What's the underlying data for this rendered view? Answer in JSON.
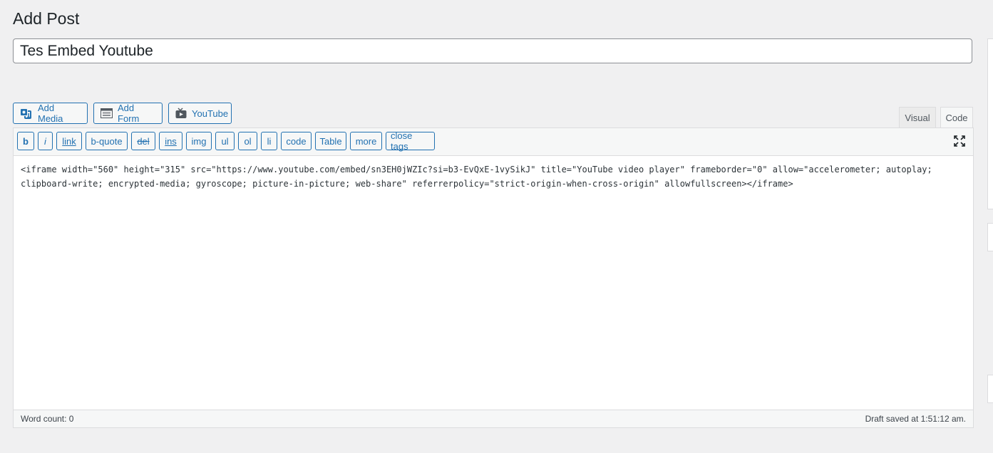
{
  "page": {
    "title": "Add Post"
  },
  "post_title": {
    "value": "Tes Embed Youtube"
  },
  "media_buttons": [
    {
      "label": "Add Media",
      "icon": "add-media-icon"
    },
    {
      "label": "Add Form",
      "icon": "form-icon"
    },
    {
      "label": "YouTube",
      "icon": "youtube-icon"
    }
  ],
  "editor_tabs": {
    "visual": "Visual",
    "code": "Code",
    "active": "Code"
  },
  "quicktags": [
    "b",
    "i",
    "link",
    "b-quote",
    "del",
    "ins",
    "img",
    "ul",
    "ol",
    "li",
    "code",
    "Table",
    "more",
    "close tags"
  ],
  "content": "<iframe width=\"560\" height=\"315\" src=\"https://www.youtube.com/embed/sn3EH0jWZIc?si=b3-EvQxE-1vySikJ\" title=\"YouTube video player\" frameborder=\"0\" allow=\"accelerometer; autoplay; clipboard-write; encrypted-media; gyroscope; picture-in-picture; web-share\" referrerpolicy=\"strict-origin-when-cross-origin\" allowfullscreen></iframe>",
  "status": {
    "word_count": "Word count: 0",
    "draft_saved": "Draft saved at 1:51:12 am."
  },
  "colors": {
    "accent": "#2271b1",
    "background": "#f0f0f1"
  }
}
